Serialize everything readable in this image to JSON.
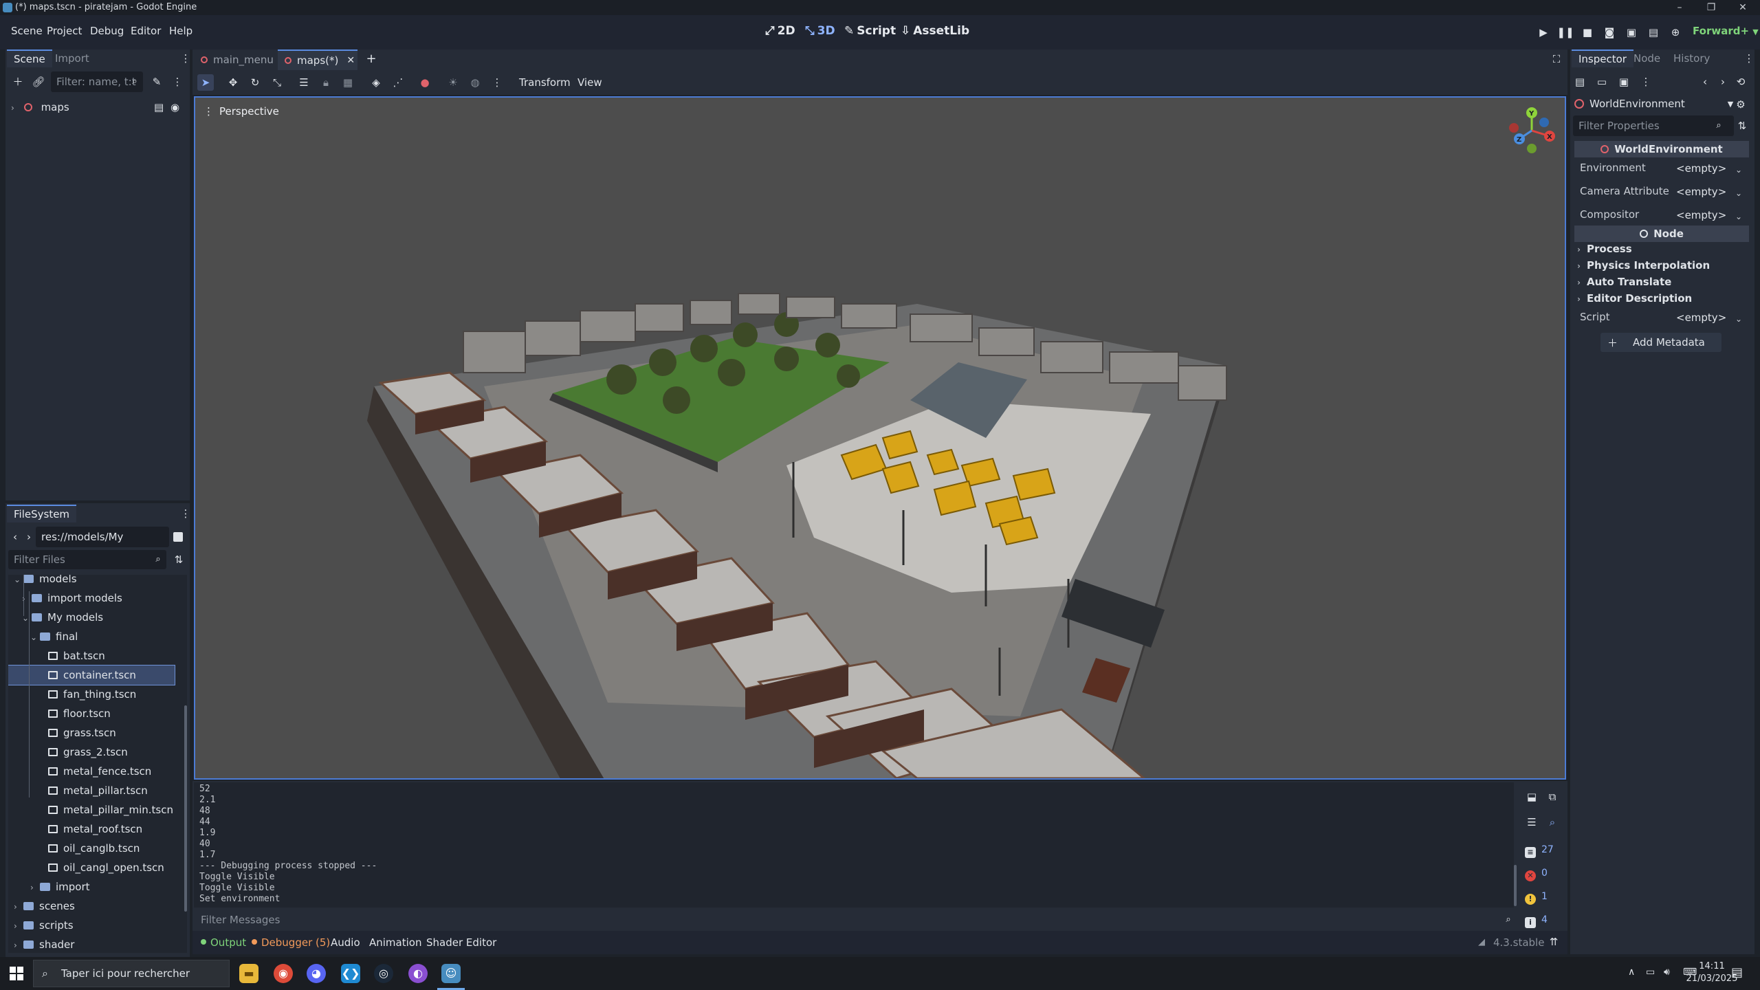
{
  "window": {
    "title": "(*) maps.tscn - piratejam - Godot Engine",
    "minimize": "–",
    "maximize": "❐",
    "close": "✕"
  },
  "menu": {
    "items": [
      "Scene",
      "Project",
      "Debug",
      "Editor",
      "Help"
    ],
    "workspaces": [
      "2D",
      "3D",
      "Script",
      "AssetLib"
    ],
    "active_workspace": "3D",
    "renderer": "Forward+"
  },
  "scene_dock": {
    "tabs": [
      "Scene",
      "Import"
    ],
    "filter_placeholder": "Filter: name, t:t",
    "root_node": "maps"
  },
  "filesystem": {
    "title": "FileSystem",
    "path": "res://models/My models/fin",
    "filter_placeholder": "Filter Files",
    "tree": [
      {
        "label": "models",
        "type": "folder",
        "depth": 1,
        "expanded": true
      },
      {
        "label": "import models",
        "type": "folder",
        "depth": 2,
        "expanded": false
      },
      {
        "label": "My models",
        "type": "folder",
        "depth": 2,
        "expanded": true
      },
      {
        "label": "final",
        "type": "folder",
        "depth": 3,
        "expanded": true
      },
      {
        "label": "bat.tscn",
        "type": "scene",
        "depth": 4
      },
      {
        "label": "container.tscn",
        "type": "scene",
        "depth": 4,
        "selected": true
      },
      {
        "label": "fan_thing.tscn",
        "type": "scene",
        "depth": 4
      },
      {
        "label": "floor.tscn",
        "type": "scene",
        "depth": 4
      },
      {
        "label": "grass.tscn",
        "type": "scene",
        "depth": 4
      },
      {
        "label": "grass_2.tscn",
        "type": "scene",
        "depth": 4
      },
      {
        "label": "metal_fence.tscn",
        "type": "scene",
        "depth": 4
      },
      {
        "label": "metal_pillar.tscn",
        "type": "scene",
        "depth": 4
      },
      {
        "label": "metal_pillar_min.tscn",
        "type": "scene",
        "depth": 4
      },
      {
        "label": "metal_roof.tscn",
        "type": "scene",
        "depth": 4
      },
      {
        "label": "oil_canglb.tscn",
        "type": "scene",
        "depth": 4
      },
      {
        "label": "oil_cangl_open.tscn",
        "type": "scene",
        "depth": 4
      },
      {
        "label": "import",
        "type": "folder",
        "depth": 3,
        "expanded": false
      },
      {
        "label": "scenes",
        "type": "folder",
        "depth": 1,
        "expanded": false
      },
      {
        "label": "scripts",
        "type": "folder",
        "depth": 1,
        "expanded": false
      },
      {
        "label": "shader",
        "type": "folder",
        "depth": 1,
        "expanded": false
      }
    ]
  },
  "editor_tabs": [
    {
      "label": "main_menu",
      "active": false
    },
    {
      "label": "maps(*)",
      "active": true
    }
  ],
  "viewport_toolbar": {
    "transform": "Transform",
    "view": "View",
    "perspective": "Perspective"
  },
  "gizmo": {
    "y": "Y",
    "x": "X",
    "z": "Z"
  },
  "output": {
    "lines": [
      "52",
      "2.1",
      "48",
      "44",
      "1.9",
      "40",
      "1.7",
      "--- Debugging process stopped ---",
      "Toggle Visible",
      "Toggle Visible",
      "Set environment"
    ],
    "filter_placeholder": "Filter Messages",
    "counts": {
      "messages": "27",
      "errors": "0",
      "warnings": "1",
      "info": "4"
    }
  },
  "bottom_panel": {
    "tabs": [
      "Output",
      "Debugger (5)",
      "Audio",
      "Animation",
      "Shader Editor"
    ],
    "version": "4.3.stable"
  },
  "inspector": {
    "tabs": [
      "Inspector",
      "Node",
      "History"
    ],
    "selected_node": "WorldEnvironment",
    "filter_placeholder": "Filter Properties",
    "class_header": "WorldEnvironment",
    "properties": [
      {
        "name": "Environment",
        "value": "<empty>"
      },
      {
        "name": "Camera Attribute",
        "value": "<empty>"
      },
      {
        "name": "Compositor",
        "value": "<empty>"
      }
    ],
    "node_header": "Node",
    "sections": [
      "Process",
      "Physics Interpolation",
      "Auto Translate",
      "Editor Description"
    ],
    "script": {
      "name": "Script",
      "value": "<empty>"
    },
    "add_metadata": "Add Metadata"
  },
  "taskbar": {
    "search_placeholder": "Taper ici pour rechercher",
    "time": "14:11",
    "date": "21/03/2025"
  }
}
